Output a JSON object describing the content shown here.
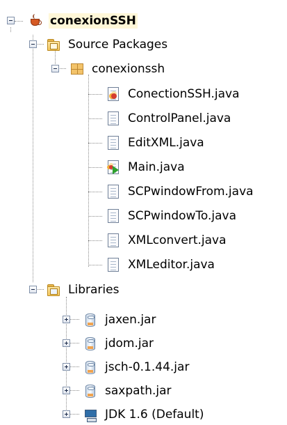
{
  "root": {
    "label": "conexionSSH",
    "icon": "project-cup-icon"
  },
  "source_packages": {
    "label": "Source Packages",
    "icon": "source-folder-icon",
    "package": {
      "label": "conexionssh",
      "icon": "package-icon",
      "files": [
        {
          "label": "ConectionSSH.java",
          "icon": "java-class-error-icon"
        },
        {
          "label": "ControlPanel.java",
          "icon": "java-file-icon"
        },
        {
          "label": "EditXML.java",
          "icon": "java-file-icon"
        },
        {
          "label": "Main.java",
          "icon": "java-main-run-icon"
        },
        {
          "label": "SCPwindowFrom.java",
          "icon": "java-file-icon"
        },
        {
          "label": "SCPwindowTo.java",
          "icon": "java-file-icon"
        },
        {
          "label": "XMLconvert.java",
          "icon": "java-file-icon"
        },
        {
          "label": "XMLeditor.java",
          "icon": "java-file-icon"
        }
      ]
    }
  },
  "libraries": {
    "label": "Libraries",
    "icon": "libraries-folder-icon",
    "items": [
      {
        "label": "jaxen.jar",
        "icon": "jar-icon"
      },
      {
        "label": "jdom.jar",
        "icon": "jar-icon"
      },
      {
        "label": "jsch-0.1.44.jar",
        "icon": "jar-icon"
      },
      {
        "label": "saxpath.jar",
        "icon": "jar-icon"
      },
      {
        "label": "JDK 1.6 (Default)",
        "icon": "jdk-icon"
      }
    ]
  }
}
